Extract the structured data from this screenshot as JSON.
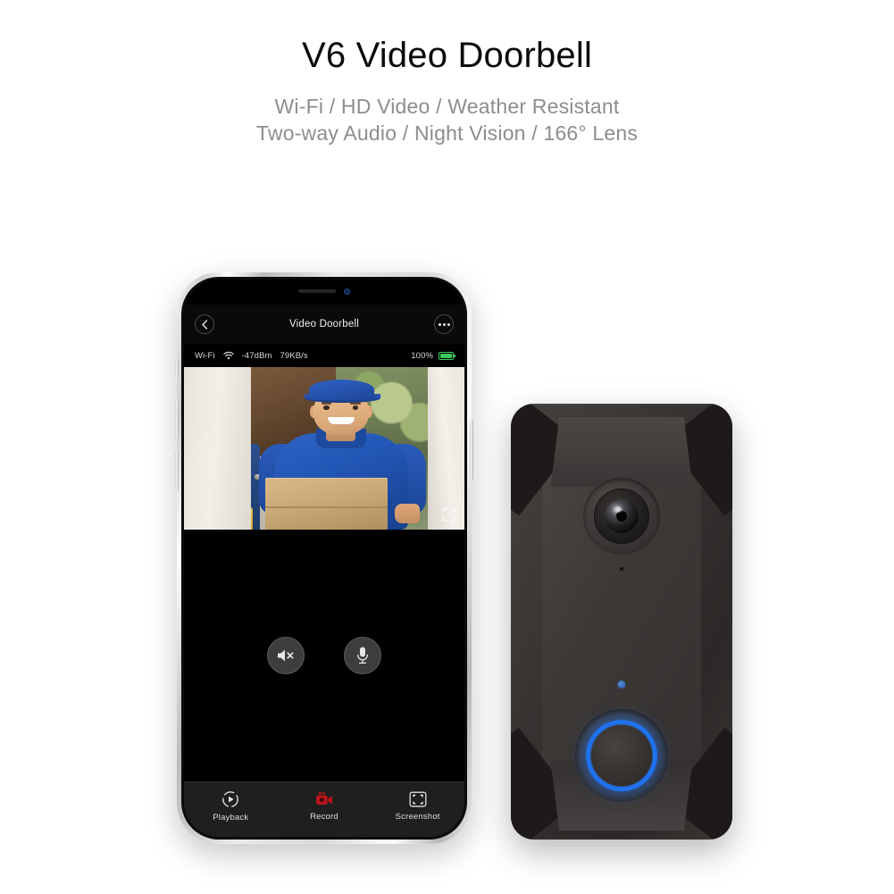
{
  "header": {
    "title": "V6 Video Doorbell",
    "subtitle_line1": "Wi-Fi / HD Video / Weather Resistant",
    "subtitle_line2": "Two-way Audio / Night Vision / 166° Lens"
  },
  "phone": {
    "appbar": {
      "back_icon": "chevron-left-icon",
      "title": "Video Doorbell",
      "more_icon": "more-options-icon"
    },
    "status": {
      "network_label": "Wi-Fi",
      "signal_icon": "wifi-signal-icon",
      "signal_strength": "-47dBm",
      "bitrate": "79KB/s",
      "battery_percent": "100%",
      "battery_icon": "battery-charging-icon"
    },
    "feed": {
      "fullscreen_icon": "fullscreen-icon",
      "scene_description": "Delivery person in blue polo shirt and blue cap holding a cardboard box at a doorway"
    },
    "controls": [
      {
        "name": "speaker-mute-button",
        "icon": "speaker-muted-icon"
      },
      {
        "name": "microphone-button",
        "icon": "microphone-icon"
      }
    ],
    "toolbar": [
      {
        "name": "playback",
        "label": "Playback",
        "icon": "playback-circle-icon"
      },
      {
        "name": "record",
        "label": "Record",
        "icon": "video-camera-record-icon"
      },
      {
        "name": "screenshot",
        "label": "Screenshot",
        "icon": "screenshot-frame-icon"
      }
    ]
  },
  "doorbell": {
    "camera_icon": "fisheye-camera-lens",
    "mic_icon": "microphone-pinhole",
    "led_icon": "status-led-indicator",
    "button_icon": "doorbell-ring-button"
  },
  "colors": {
    "title": "#0b0b0b",
    "subtitle": "#8d8d8d",
    "accent_blue": "#1f72ee",
    "record_red": "#b5161c",
    "battery_green": "#3ecb5e",
    "screen_black": "#000000",
    "device_body": "#3b3836"
  }
}
